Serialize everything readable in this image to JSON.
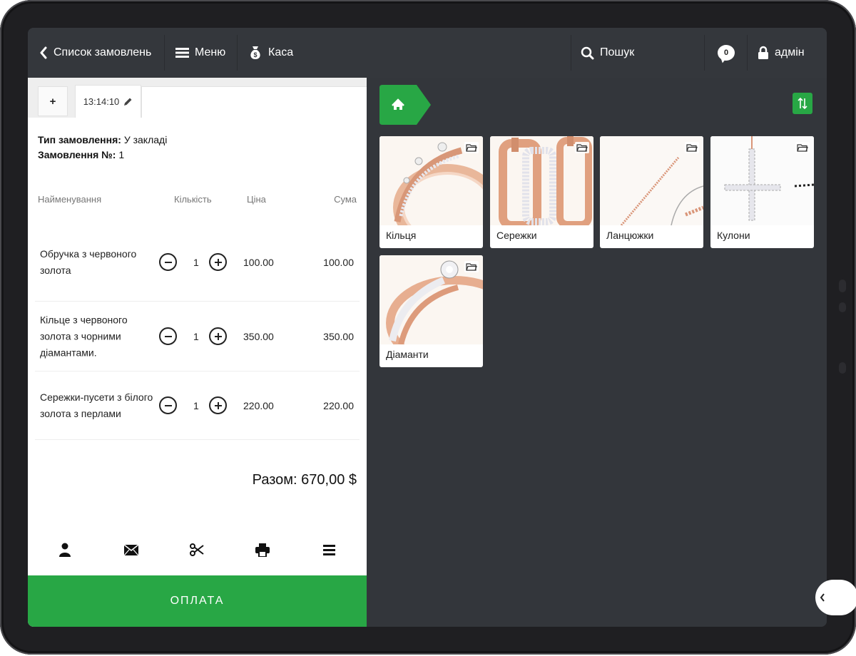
{
  "topbar": {
    "orders_list_label": "Список замовлень",
    "menu_label": "Меню",
    "cash_label": "Каса",
    "search_label": "Пошук",
    "notifications_count": "0",
    "user_label": "адмін"
  },
  "order": {
    "new_tab_label": "+",
    "active_tab_time": "13:14:10",
    "type_label": "Тип замовлення:",
    "type_value": "У закладі",
    "number_label": "Замовлення №:",
    "number_value": "1",
    "columns": {
      "name": "Найменування",
      "qty": "Кількість",
      "price": "Ціна",
      "sum": "Сума"
    },
    "items": [
      {
        "name": "Обручка з червоного золота",
        "qty": "1",
        "price": "100.00",
        "sum": "100.00"
      },
      {
        "name": "Кільце з червоного золота з чорними діамантами.",
        "qty": "1",
        "price": "350.00",
        "sum": "350.00"
      },
      {
        "name": "Сережки-пусети з білого золота з перлами",
        "qty": "1",
        "price": "220.00",
        "sum": "220.00"
      }
    ],
    "total": "Разом: 670,00 $",
    "actions": [
      "user-icon",
      "envelope-icon",
      "scissors-icon",
      "printer-icon",
      "list-icon"
    ],
    "pay_label": "ОПЛАТА"
  },
  "catalog": {
    "categories": [
      {
        "label": "Кільця",
        "icon": "ring-image"
      },
      {
        "label": "Сережки",
        "icon": "earrings-image"
      },
      {
        "label": "Ланцюжки",
        "icon": "chain-image"
      },
      {
        "label": "Кулони",
        "icon": "pendant-cross-image"
      },
      {
        "label": "Діаманти",
        "icon": "diamond-ring-image"
      }
    ]
  },
  "colors": {
    "accent_green": "#28a745",
    "dark_panel": "#33363b",
    "topbar": "#34373c"
  }
}
